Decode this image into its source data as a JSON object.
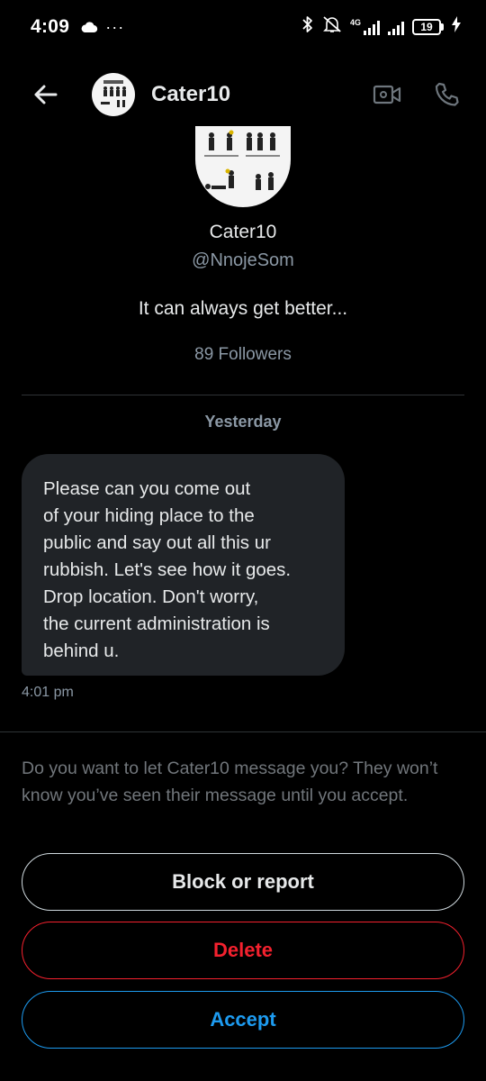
{
  "status_bar": {
    "time": "4:09",
    "more": "···",
    "network": "4G",
    "battery": "19"
  },
  "header": {
    "name": "Cater10",
    "icons": [
      "back-arrow-icon",
      "video-call-icon",
      "phone-call-icon"
    ]
  },
  "profile": {
    "name": "Cater10",
    "handle": "@NnojeSom",
    "bio": "It can always get better...",
    "followers": "89 Followers"
  },
  "conversation": {
    "day_label": "Yesterday",
    "message_lines": [
      "Please can you come out",
      "of your hiding place to the",
      "public and say out all this ur",
      "rubbish. Let's see how it goes.",
      "Drop location. Don't worry,",
      "the current administration is",
      "behind u."
    ],
    "time": "4:01 pm"
  },
  "request": {
    "text": "Do you want to let Cater10 message you? They won’t know you’ve seen their message until you accept.",
    "block_label": "Block or report",
    "delete_label": "Delete",
    "accept_label": "Accept"
  },
  "colors": {
    "background": "#000000",
    "bubble": "#202327",
    "muted": "#8b98a5",
    "delete": "#f4212e",
    "accept": "#1d9bf0"
  }
}
